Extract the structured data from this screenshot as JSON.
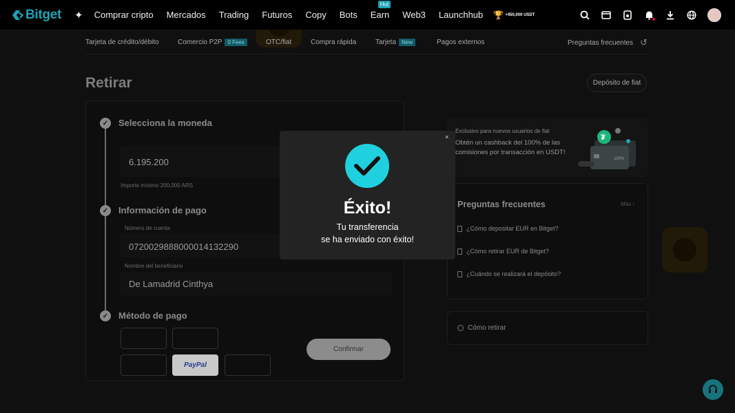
{
  "header": {
    "logo_text": "Bitget",
    "nav": [
      "Comprar cripto",
      "Mercados",
      "Trading",
      "Futuros",
      "Copy",
      "Bots",
      "Earn",
      "Web3",
      "Launchhub"
    ],
    "earn_badge": "Hot",
    "promo_text": "+450,000 USDT",
    "icons": [
      "search-icon",
      "wallet-icon",
      "orders-icon",
      "bell-icon",
      "download-icon",
      "globe-icon"
    ]
  },
  "subnav": {
    "items": [
      {
        "label": "Tarjeta de crédito/débito"
      },
      {
        "label": "Comercio P2P",
        "tag": "0 Fees"
      },
      {
        "label": "OTC/fiat"
      },
      {
        "label": "Compra rápida"
      },
      {
        "label": "Tarjeta",
        "tag": "New"
      },
      {
        "label": "Pagos externos"
      }
    ],
    "faq_link": "Preguntas frecuentes"
  },
  "page": {
    "title": "Retirar",
    "fiat_deposit_button": "Depósito de fiat"
  },
  "form": {
    "step1_title": "Selecciona la moneda",
    "amount_value": "6.195.200",
    "amount_hint": "Importe mínimo 200,000 ARS",
    "step2_title": "Información de pago",
    "account_label": "Número de cuenta",
    "account_value": "0720029888000014132290",
    "beneficiary_label": "Nombre del beneficiario",
    "beneficiary_value": "De Lamadrid Cinthya",
    "step3_title": "Método de pago",
    "paypal_label": "PayPal",
    "confirm_button": "Confirmar"
  },
  "sidebar": {
    "banner_line1": "Exclusivo para nuevos usuarios de fiat",
    "banner_line2": "Obtén un cashback del 100% de las comisiones por transacción en USDT!",
    "card_pct": "100%",
    "faq_title": "Preguntas frecuentes",
    "faq_more": "Más",
    "faq_items": [
      "¿Cómo depositar EUR en Bitget?",
      "¿Cómo retirar EUR de Bitget?",
      "¿Cuándo se realizará el depósito?"
    ],
    "how_to": "Cómo retirar"
  },
  "modal": {
    "title": "Éxito!",
    "line1": "Tu transferencia",
    "line2": "se ha enviado con éxito!",
    "close": "×"
  },
  "colors": {
    "brand": "#1da2b4",
    "success": "#1fd1de"
  }
}
